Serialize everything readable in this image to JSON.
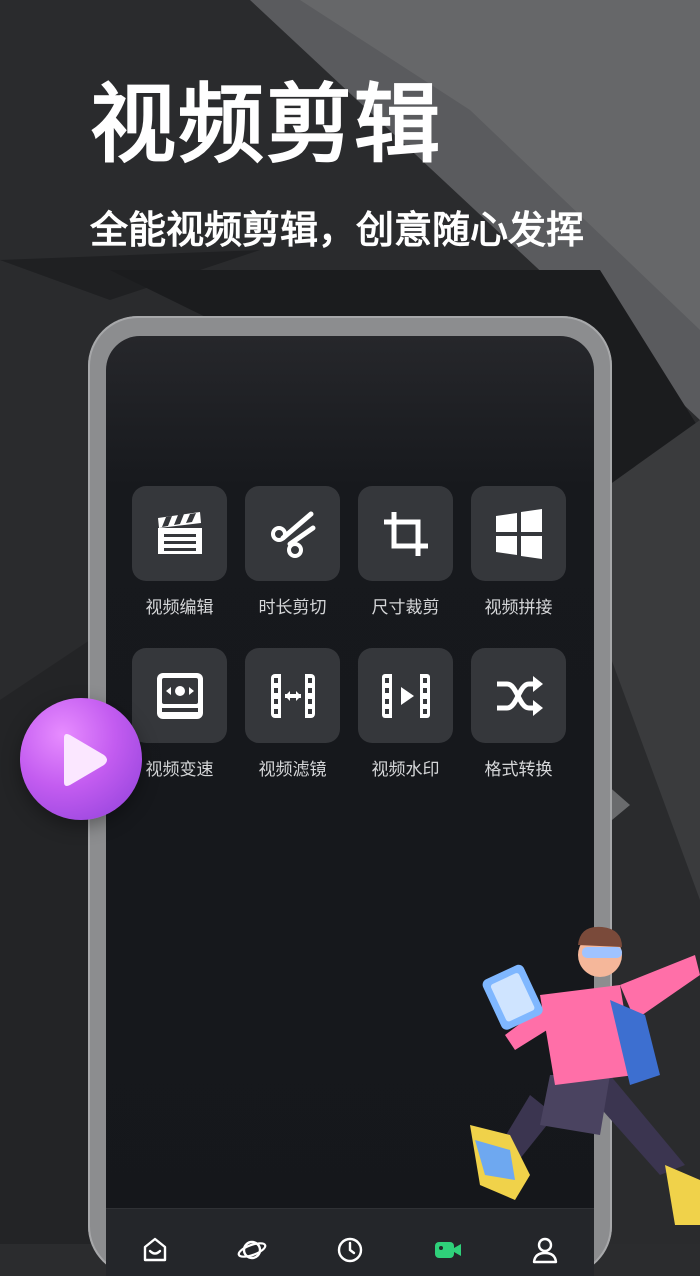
{
  "hero": {
    "title": "视频剪辑",
    "subtitle": "全能视频剪辑，创意随心发挥"
  },
  "tools": [
    {
      "label": "视频编辑",
      "icon": "clapperboard-icon"
    },
    {
      "label": "时长剪切",
      "icon": "scissors-icon"
    },
    {
      "label": "尺寸裁剪",
      "icon": "crop-icon"
    },
    {
      "label": "视频拼接",
      "icon": "grid-tiles-icon"
    },
    {
      "label": "视频变速",
      "icon": "speed-icon"
    },
    {
      "label": "视频滤镜",
      "icon": "film-strip-icon"
    },
    {
      "label": "视频水印",
      "icon": "film-play-icon"
    },
    {
      "label": "格式转换",
      "icon": "shuffle-icon"
    }
  ],
  "tabbar": [
    {
      "icon": "home-icon",
      "active": false
    },
    {
      "icon": "planet-icon",
      "active": false
    },
    {
      "icon": "clock-icon",
      "active": false
    },
    {
      "icon": "video-camera-icon",
      "active": true
    },
    {
      "icon": "profile-icon",
      "active": false
    }
  ],
  "colors": {
    "accent": "#2fd07a",
    "tile": "#35373b",
    "badge": "#c35cf0"
  }
}
